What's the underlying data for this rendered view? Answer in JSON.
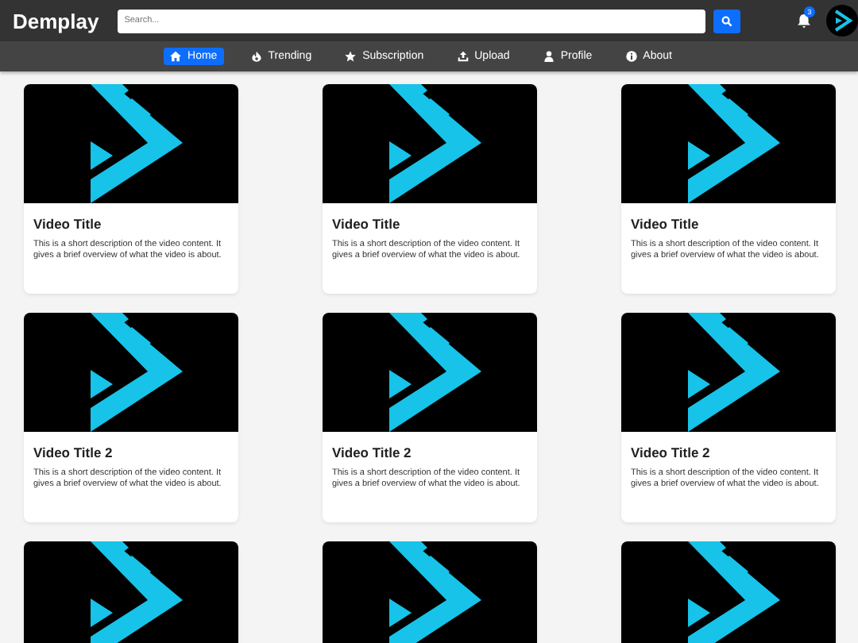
{
  "header": {
    "brand": "Demplay",
    "search": {
      "placeholder": "Search..."
    },
    "notifications": {
      "count": "3"
    }
  },
  "nav": [
    {
      "label": "Home",
      "kind": "home",
      "selected": true
    },
    {
      "label": "Trending",
      "kind": "trending",
      "selected": false
    },
    {
      "label": "Subscription",
      "kind": "subscription",
      "selected": false
    },
    {
      "label": "Upload",
      "kind": "upload",
      "selected": false
    },
    {
      "label": "Profile",
      "kind": "profile",
      "selected": false
    },
    {
      "label": "About",
      "kind": "about",
      "selected": false
    }
  ],
  "videos": [
    {
      "kind": "video",
      "title": "Video Title",
      "description": "This is a short description of the video content. It gives a brief overview of what the video is about."
    },
    {
      "kind": "video",
      "title": "Video Title",
      "description": "This is a short description of the video content. It gives a brief overview of what the video is about."
    },
    {
      "kind": "video",
      "title": "Video Title",
      "description": "This is a short description of the video content. It gives a brief overview of what the video is about."
    },
    {
      "kind": "video",
      "title": "Video Title 2",
      "description": "This is a short description of the video content. It gives a brief overview of what the video is about."
    },
    {
      "kind": "video",
      "title": "Video Title 2",
      "description": "This is a short description of the video content. It gives a brief overview of what the video is about."
    },
    {
      "kind": "video",
      "title": "Video Title 2",
      "description": "This is a short description of the video content. It gives a brief overview of what the video is about."
    },
    {
      "kind": "thumbnail"
    },
    {
      "kind": "thumbnail"
    },
    {
      "kind": "thumbnail"
    }
  ]
}
